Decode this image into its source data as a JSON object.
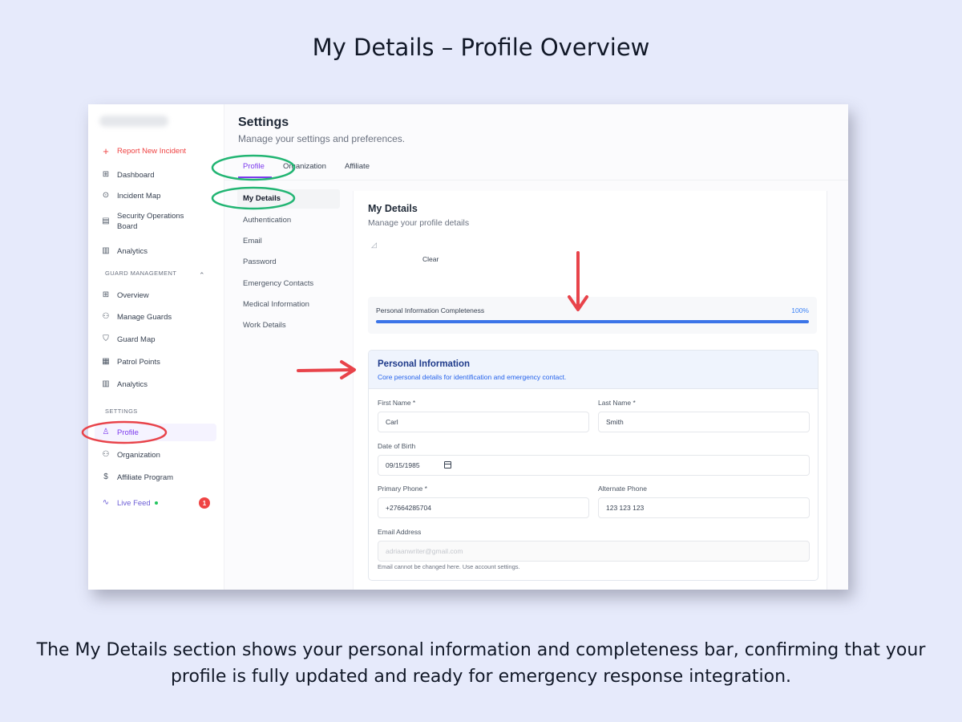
{
  "heading": "My Details – Profile Overview",
  "caption": "The My Details section shows your personal information and completeness bar, confirming that your profile is fully updated and ready for emergency response integration.",
  "sidebar": {
    "report": "Report New Incident",
    "items_top": [
      {
        "label": "Dashboard",
        "icon": "grid-icon"
      },
      {
        "label": "Incident Map",
        "icon": "map-pin-icon"
      },
      {
        "label": "Security Operations Board",
        "icon": "building-icon"
      },
      {
        "label": "Analytics",
        "icon": "bar-chart-icon"
      }
    ],
    "guard_section": "GUARD MANAGEMENT",
    "guard_items": [
      {
        "label": "Overview",
        "icon": "grid-icon"
      },
      {
        "label": "Manage Guards",
        "icon": "users-icon"
      },
      {
        "label": "Guard Map",
        "icon": "shield-icon"
      },
      {
        "label": "Patrol Points",
        "icon": "qr-code-icon"
      },
      {
        "label": "Analytics",
        "icon": "bar-chart-icon"
      }
    ],
    "settings_section": "SETTINGS",
    "settings_items": [
      {
        "label": "Profile",
        "icon": "user-icon"
      },
      {
        "label": "Organization",
        "icon": "users-icon"
      },
      {
        "label": "Affiliate Program",
        "icon": "dollar-icon"
      }
    ],
    "live_feed": "Live Feed",
    "live_badge": "1"
  },
  "main": {
    "title": "Settings",
    "subtitle": "Manage your settings and preferences.",
    "tabs": [
      "Profile",
      "Organization",
      "Affiliate"
    ],
    "subnav": [
      "My Details",
      "Authentication",
      "Email",
      "Password",
      "Emergency Contacts",
      "Medical Information",
      "Work Details"
    ],
    "my_details": {
      "title": "My Details",
      "subtitle": "Manage your profile details",
      "clear": "Clear"
    },
    "completeness": {
      "label": "Personal Information Completeness",
      "percent_label": "100%",
      "value": 1.0
    },
    "personal": {
      "title": "Personal Information",
      "subtitle": "Core personal details for identification and emergency contact.",
      "first_name_label": "First Name *",
      "first_name": "Carl",
      "last_name_label": "Last Name *",
      "last_name": "Smith",
      "dob_label": "Date of Birth",
      "dob": "09/15/1985",
      "primary_phone_label": "Primary Phone *",
      "primary_phone": "+27664285704",
      "alt_phone_label": "Alternate Phone",
      "alt_phone": "123 123 123",
      "email_label": "Email Address",
      "email": "adriaanwriter@gmail.com",
      "email_help": "Email cannot be changed here. Use account settings."
    }
  },
  "colors": {
    "accent": "#7c3aed",
    "progress": "#3b74e8",
    "highlight_green": "#22b573",
    "highlight_red": "#e8434a"
  }
}
